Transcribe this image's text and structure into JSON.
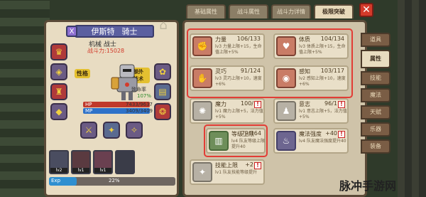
{
  "hero": {
    "name": "伊斯特",
    "role": "骑士",
    "class_icon": "X",
    "subtitle": "机械 战士",
    "power": "战斗力:15028",
    "trait_tag": "性格",
    "extra_tag": "额外技术",
    "hit_label": "致命率",
    "hit_val": "107%",
    "hp_label": "HP",
    "hp_val": "7433/9637",
    "mp_label": "MP",
    "mp_val": "3409/3409",
    "slot_levels": [
      "lv2",
      "lv1",
      "lv1"
    ],
    "exp_label": "Exp",
    "exp_pct": "22%",
    "exp_fill": 0.22
  },
  "tabs": [
    "基础属性",
    "战斗属性",
    "战斗力详情",
    "极限突破"
  ],
  "close": "✕",
  "attrs": [
    {
      "name": "力量",
      "val": "106/133",
      "desc": "lv3 力量上限+15，生命值上限+5%"
    },
    {
      "name": "体质",
      "val": "104/134",
      "desc": "lv3 体质上限+15，生命值上限+5%"
    },
    {
      "name": "灵巧",
      "val": "91/124",
      "desc": "lv3 灵巧上限+10，速度+6%"
    },
    {
      "name": "感知",
      "val": "103/117",
      "desc": "lv2 感知上限+10，速度+6%"
    },
    {
      "name": "魔力",
      "val": "100/",
      "desc": "lv1 魔力上限+5，法力值+5%"
    },
    {
      "name": "意志",
      "val": "96/1",
      "desc": "lv1 意志上限+5，法力值+5%"
    },
    {
      "name": "等级上限",
      "val": "79/164",
      "desc": "lv4 队友等级上限提升40"
    },
    {
      "name": "魔法强度",
      "val": "+40",
      "desc": "lv4 队友魔法强度提升40"
    },
    {
      "name": "技能上限",
      "val": "+2",
      "desc": "lv1 队友技能等级提升"
    }
  ],
  "side_tabs": [
    "道具",
    "属性",
    "技能",
    "魔法",
    "天赋",
    "乐器",
    "装备"
  ],
  "watermark": "脉冲手游网",
  "colors": {
    "highlight": "#e23d36",
    "panel": "#e8dcc2"
  }
}
